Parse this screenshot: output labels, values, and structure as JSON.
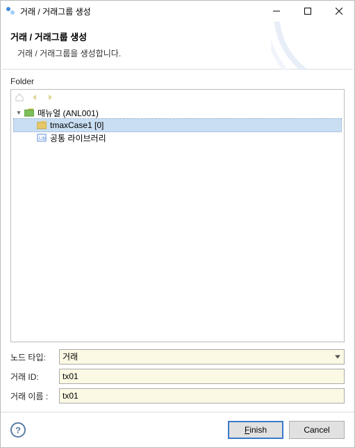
{
  "window": {
    "title": "거래 / 거래그룹 생성"
  },
  "header": {
    "title": "거래 / 거래그룹 생성",
    "description": "거래 / 거래그룹을 생성합니다."
  },
  "folder": {
    "label": "Folder",
    "tree": {
      "root": {
        "label": "매뉴얼  (ANL001)"
      },
      "child1": {
        "label": "tmaxCase1 [0]"
      },
      "child2": {
        "label": "공통 라이브러리"
      }
    }
  },
  "form": {
    "nodeType": {
      "label": "노드 타입:",
      "value": "거래"
    },
    "txId": {
      "label": "거래 ID:",
      "value": "tx01"
    },
    "txName": {
      "label": "거래 이름 :",
      "value": "tx01"
    }
  },
  "buttons": {
    "finish_prefix": "F",
    "finish_rest": "inish",
    "cancel": "Cancel"
  }
}
